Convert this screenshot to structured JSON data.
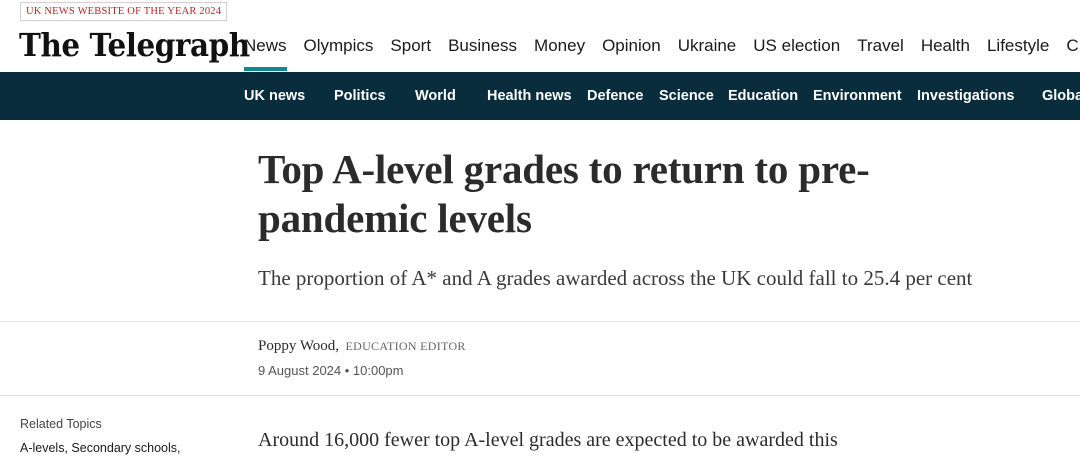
{
  "masthead": {
    "award_badge": "UK NEWS WEBSITE OF THE YEAR 2024",
    "logo_text": "The Telegraph",
    "primary_nav": [
      {
        "label": "News",
        "active": true
      },
      {
        "label": "Olympics"
      },
      {
        "label": "Sport"
      },
      {
        "label": "Business"
      },
      {
        "label": "Money"
      },
      {
        "label": "Opinion"
      },
      {
        "label": "Ukraine"
      },
      {
        "label": "US election"
      },
      {
        "label": "Travel"
      },
      {
        "label": "Health"
      },
      {
        "label": "Lifestyle"
      },
      {
        "label": "C"
      }
    ]
  },
  "secondary_nav": [
    {
      "label": "UK news"
    },
    {
      "label": "Politics"
    },
    {
      "label": "World"
    },
    {
      "label": "Health news"
    },
    {
      "label": "Defence"
    },
    {
      "label": "Science"
    },
    {
      "label": "Education"
    },
    {
      "label": "Environment"
    },
    {
      "label": "Investigations"
    },
    {
      "label": "Globa"
    }
  ],
  "article": {
    "headline_line1": "Top A-level grades to return to pre-",
    "headline_line2": "pandemic levels",
    "standfirst": "The proportion of A* and A grades awarded across the UK could fall to 25.4 per cent",
    "author_name": "Poppy Wood,",
    "author_title": "EDUCATION EDITOR",
    "date": "9 August 2024 • 10:00pm",
    "body_first_line": "Around 16,000 fewer top A-level grades are expected to be awarded this"
  },
  "related": {
    "label": "Related Topics",
    "topics": [
      "A-levels,",
      "Secondary schools,"
    ]
  },
  "colors": {
    "accent_teal": "#118889",
    "nav_bar": "#0a2d3d",
    "award_red": "#b3262a"
  }
}
